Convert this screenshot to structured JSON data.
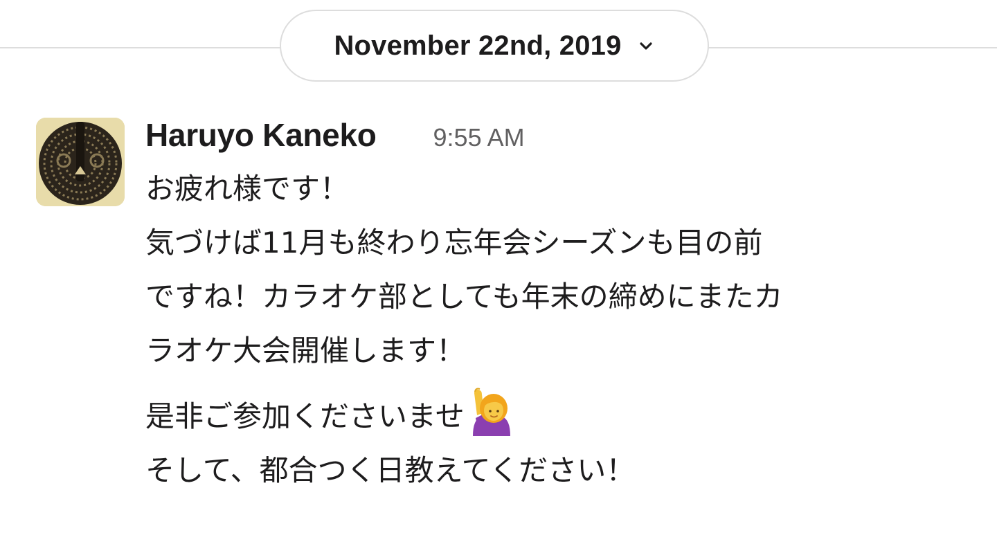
{
  "date_divider": {
    "label": "November 22nd, 2019",
    "chevron_icon": "chevron-down-icon"
  },
  "message": {
    "sender": "Haruyo Kaneko",
    "timestamp": "9:55 AM",
    "paragraphs": [
      {
        "lines": [
          "お疲れ様です！",
          "気づけば11月も終わり忘年会シーズンも目の前",
          "ですね！カラオケ部としても年末の締めにまたカ",
          "ラオケ大会開催します！"
        ]
      },
      {
        "lines": [
          "是非ご参加くださいませ",
          "そして、都合つく日教えてください！"
        ],
        "emoji": "person-raising-hand-emoji"
      }
    ]
  },
  "colors": {
    "divider": "#dddddd",
    "text": "#1d1c1d",
    "timestamp": "#616061"
  }
}
